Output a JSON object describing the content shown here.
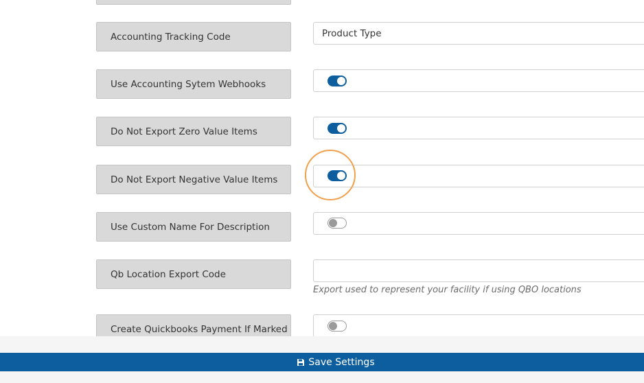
{
  "settings": [
    {
      "label": "Accounting Tracking Code",
      "type": "text",
      "value": "Product Type"
    },
    {
      "label": "Use Accounting Sytem Webhooks",
      "type": "toggle",
      "enabled": true
    },
    {
      "label": "Do Not Export Zero Value Items",
      "type": "toggle",
      "enabled": true
    },
    {
      "label": "Do Not Export Negative Value Items",
      "type": "toggle",
      "enabled": true
    },
    {
      "label": "Use Custom Name For Description",
      "type": "toggle",
      "enabled": false
    },
    {
      "label": "Qb Location Export Code",
      "type": "text",
      "value": "",
      "help": "Export used to represent your facility if using QBO locations"
    },
    {
      "label": "Create Quickbooks Payment If Marked",
      "type": "toggle",
      "enabled": false
    }
  ],
  "save_button": {
    "label": "Save Settings",
    "icon": "floppy-disk-icon"
  },
  "colors": {
    "accent": "#0d5e9e",
    "highlight": "#f0a04b",
    "label_bg": "#d9d9d9"
  }
}
